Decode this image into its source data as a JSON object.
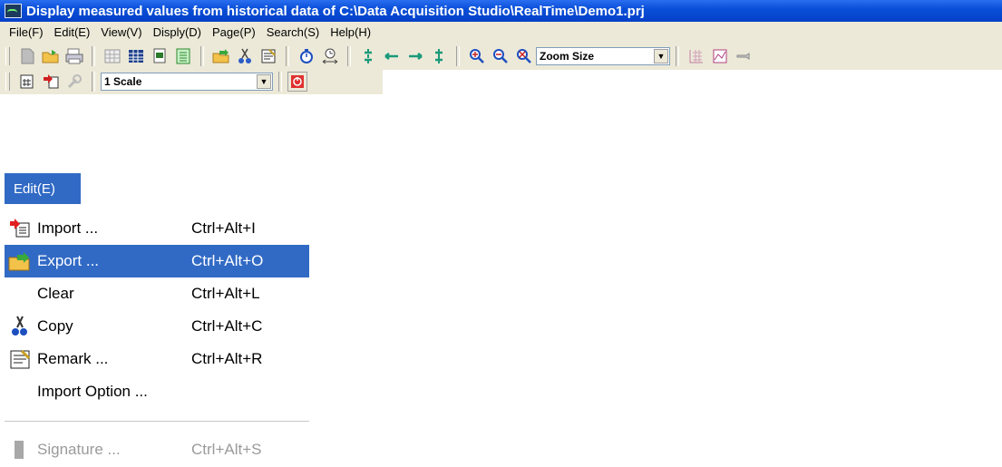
{
  "window": {
    "title": "Display measured values from historical data of C:\\Data Acquisition Studio\\RealTime\\Demo1.prj"
  },
  "menubar": {
    "items": [
      "File(F)",
      "Edit(E)",
      "View(V)",
      "Disply(D)",
      "Page(P)",
      "Search(S)",
      "Help(H)"
    ]
  },
  "toolbar": {
    "zoom_combo": "Zoom Size",
    "scale_combo": "1 Scale"
  },
  "edit_menu": {
    "title": "Edit(E)",
    "items": [
      {
        "label": "Import ...",
        "shortcut": "Ctrl+Alt+I",
        "icon": "import-icon"
      },
      {
        "label": "Export ...",
        "shortcut": "Ctrl+Alt+O",
        "icon": "export-icon",
        "highlighted": true
      },
      {
        "label": "Clear",
        "shortcut": "Ctrl+Alt+L"
      },
      {
        "label": "Copy",
        "shortcut": "Ctrl+Alt+C",
        "icon": "scissors-icon"
      },
      {
        "label": "Remark ...",
        "shortcut": "Ctrl+Alt+R",
        "icon": "remark-icon"
      },
      {
        "label": "Import Option ...",
        "shortcut": ""
      },
      {
        "label": "Signature ...",
        "shortcut": "Ctrl+Alt+S",
        "icon": "signature-icon",
        "disabled": true
      }
    ]
  },
  "colors": {
    "titlebar": "#0a4fd8",
    "menu_highlight": "#316ac5",
    "chrome": "#ece9d8"
  }
}
